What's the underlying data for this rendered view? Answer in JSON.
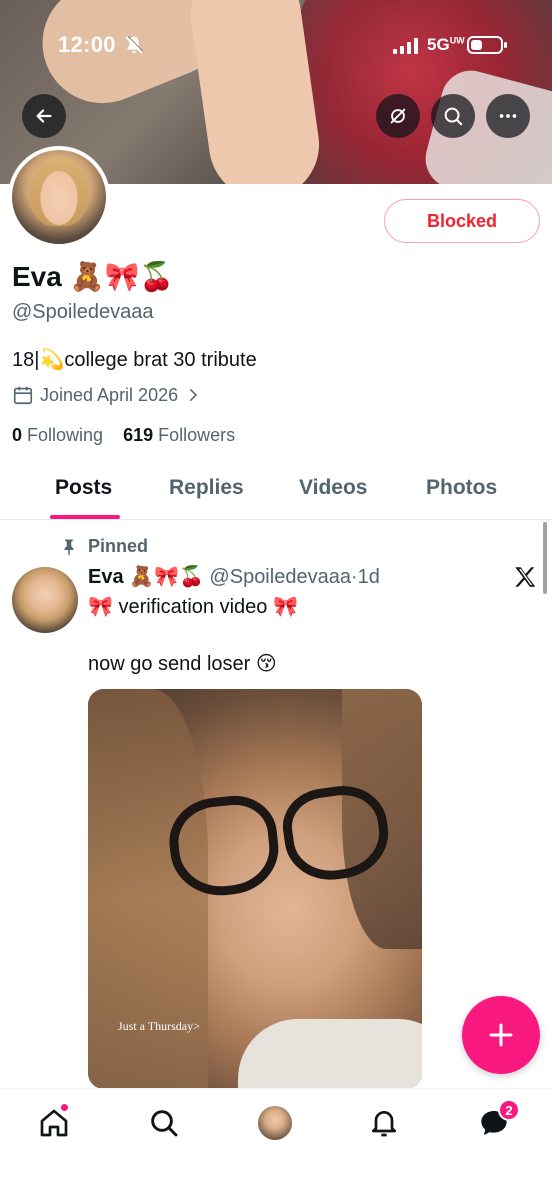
{
  "status_bar": {
    "time": "12:00",
    "network": "5G",
    "network_sup": "UW"
  },
  "profile": {
    "name": "Eva 🧸🎀🍒",
    "handle": "@Spoiledevaaa",
    "bio": "18|💫college brat 30 tribute",
    "joined": "Joined April 2026",
    "following_count": "0",
    "following_label": "Following",
    "followers_count": "619",
    "followers_label": "Followers",
    "blocked_label": "Blocked"
  },
  "tabs": [
    "Posts",
    "Replies",
    "Videos",
    "Photos"
  ],
  "post": {
    "pinned_label": "Pinned",
    "author_name": "Eva 🧸🎀🍒",
    "author_handle": "@Spoiledevaaa",
    "separator": "·",
    "time": "1d",
    "text_line1": "🎀 verification video 🎀",
    "text_line2": "now go send loser 😚",
    "media_caption": "Just a Thursday>"
  },
  "bottom_nav": {
    "messages_badge": "2"
  },
  "colors": {
    "accent": "#f91880",
    "blocked_red": "#f4212e",
    "secondary_text": "#536471"
  },
  "icons": [
    "back-arrow-icon",
    "no-translation-icon",
    "search-icon",
    "more-icon",
    "calendar-icon",
    "chevron-right-icon",
    "pin-icon",
    "x-logo-icon",
    "plus-icon",
    "home-icon",
    "search-icon",
    "bell-icon",
    "messages-icon"
  ]
}
